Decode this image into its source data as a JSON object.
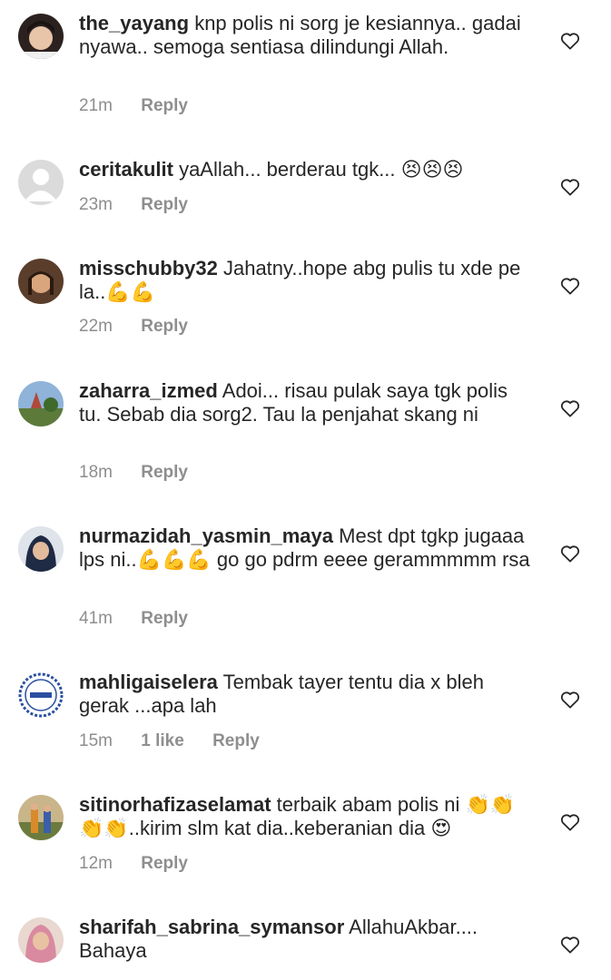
{
  "colors": {
    "text": "#262626",
    "meta": "#8e8e8e",
    "background": "#ffffff"
  },
  "comments": [
    {
      "username": "the_yayang",
      "text": "knp polis ni sorg je kesiannya.. gadai nyawa.. semoga sentiasa dilindungi Allah.",
      "time": "21m",
      "likes": "",
      "reply": "Reply"
    },
    {
      "username": "ceritakulit",
      "text": "yaAllah... berderau tgk... 😣😣😣",
      "time": "23m",
      "likes": "",
      "reply": "Reply"
    },
    {
      "username": "misschubby32",
      "text": "Jahatny..hope abg pulis tu xde pe la..💪💪",
      "time": "22m",
      "likes": "",
      "reply": "Reply"
    },
    {
      "username": "zaharra_izmed",
      "text": "Adoi... risau pulak saya tgk polis tu. Sebab dia sorg2. Tau la penjahat skang ni",
      "time": "18m",
      "likes": "",
      "reply": "Reply"
    },
    {
      "username": "nurmazidah_yasmin_maya",
      "text": "Mest dpt tgkp jugaaa lps ni..💪💪💪 go go pdrm eeee gerammmmm rsa",
      "time": "41m",
      "likes": "",
      "reply": "Reply"
    },
    {
      "username": "mahligaiselera",
      "text": "Tembak tayer tentu dia x bleh gerak ...apa lah",
      "time": "15m",
      "likes": "1 like",
      "reply": "Reply"
    },
    {
      "username": "sitinorhafizaselamat",
      "text": "terbaik abam polis ni 👏👏👏👏..kirim slm kat dia..keberanian dia 😍",
      "time": "12m",
      "likes": "",
      "reply": "Reply"
    },
    {
      "username": "sharifah_sabrina_symansor",
      "text": "AllahuAkbar.... Bahaya",
      "time": "",
      "likes": "",
      "reply": ""
    }
  ]
}
